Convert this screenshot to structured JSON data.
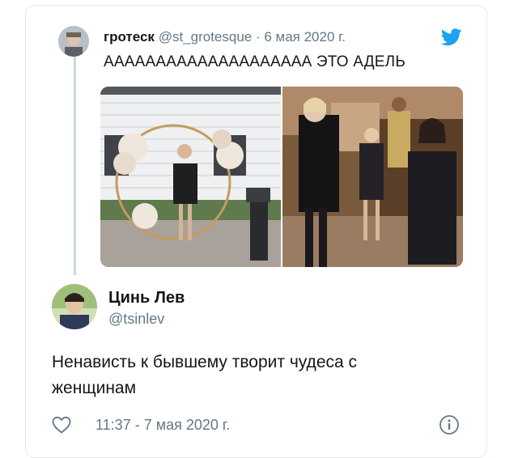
{
  "quoted_tweet": {
    "name": "гротеск",
    "meta": "@st_grotesque · 6 мая 2020 г.",
    "text": "АААААААААААААААААААА ЭТО АДЕЛЬ"
  },
  "tweet": {
    "author_name": "Цинь Лев",
    "author_handle": "@tsinlev",
    "text_line1": "Ненависть к бывшему творит чудеса с",
    "text_line2": "женщинам",
    "timestamp": "11:37 - 7 мая 2020 г."
  },
  "icons": {
    "brand": "twitter-bird-icon",
    "like": "heart-icon",
    "info": "info-icon"
  },
  "colors": {
    "brand": "#1da1f2",
    "secondary_text": "#657786",
    "thread_line": "#ccd6dd"
  }
}
